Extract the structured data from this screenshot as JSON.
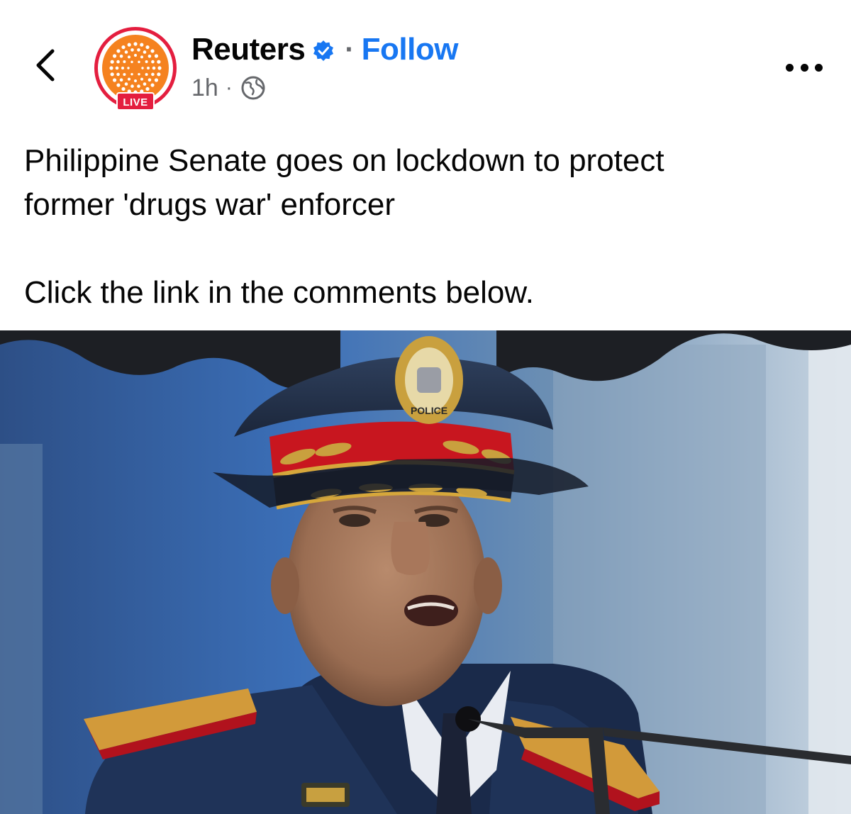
{
  "post": {
    "page_name": "Reuters",
    "follow_label": "Follow",
    "separator": "·",
    "time": "1h",
    "meta_separator": "·",
    "live_badge": "LIVE",
    "text_lines": [
      "Philippine Senate goes on lockdown to protect",
      "former 'drugs war' enforcer",
      "Click the link in the comments below."
    ],
    "image_badge_text": "POLICE"
  },
  "icons": {
    "back": "chevron-left-icon",
    "verified": "verified-badge-icon",
    "audience": "globe-icon",
    "more": "more-options-icon"
  },
  "colors": {
    "follow": "#1877f2",
    "live": "#e41e3f",
    "avatar_orange": "#f5821f",
    "secondary_text": "#65676b"
  }
}
